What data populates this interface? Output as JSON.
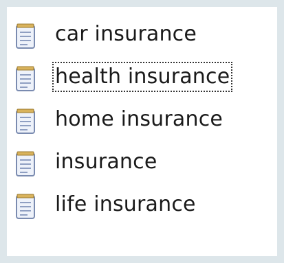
{
  "list": {
    "items": [
      {
        "label": "car insurance",
        "icon": "text-document-icon",
        "focused": false
      },
      {
        "label": "health insurance",
        "icon": "text-document-icon",
        "focused": true
      },
      {
        "label": "home insurance",
        "icon": "text-document-icon",
        "focused": false
      },
      {
        "label": "insurance",
        "icon": "text-document-icon",
        "focused": false
      },
      {
        "label": "life insurance",
        "icon": "text-document-icon",
        "focused": false
      }
    ]
  }
}
